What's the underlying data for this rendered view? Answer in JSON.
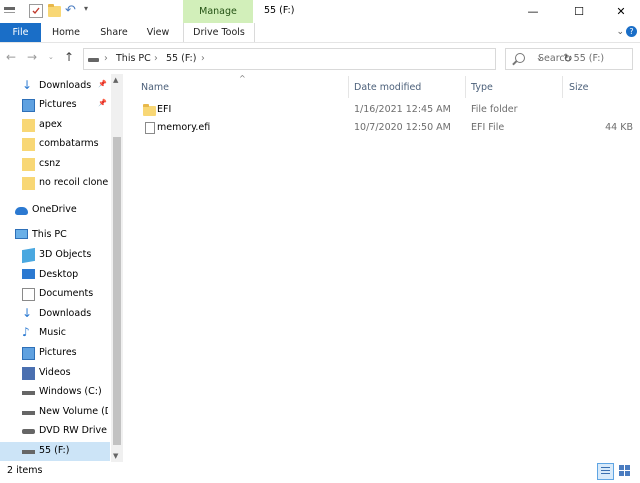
{
  "window": {
    "title": "55 (F:)",
    "controls": {
      "minimize": "—",
      "maximize": "☐",
      "close": "✕"
    }
  },
  "ribbon": {
    "context_group": "Manage",
    "tabs": [
      "File",
      "Home",
      "Share",
      "View",
      "Drive Tools"
    ],
    "help": "?"
  },
  "address": {
    "breadcrumb": [
      "This PC",
      "55 (F:)"
    ],
    "separator": "›",
    "search_placeholder": "Search 55 (F:)"
  },
  "nav_pane": {
    "items": [
      {
        "label": "Downloads",
        "icon": "downloads-icon",
        "pinned": true
      },
      {
        "label": "Pictures",
        "icon": "pictures-icon",
        "pinned": true
      },
      {
        "label": "apex",
        "icon": "folder-icon",
        "pinned": false
      },
      {
        "label": "combatarms",
        "icon": "folder-icon",
        "pinned": false
      },
      {
        "label": "csnz",
        "icon": "folder-icon",
        "pinned": false
      },
      {
        "label": "no recoil clones",
        "icon": "folder-icon",
        "pinned": false
      },
      {
        "label": "OneDrive",
        "icon": "onedrive-icon",
        "pinned": false
      },
      {
        "label": "This PC",
        "icon": "this-pc-icon",
        "pinned": false
      },
      {
        "label": "3D Objects",
        "icon": "3d-objects-icon",
        "pinned": false
      },
      {
        "label": "Desktop",
        "icon": "desktop-icon",
        "pinned": false
      },
      {
        "label": "Documents",
        "icon": "documents-icon",
        "pinned": false
      },
      {
        "label": "Downloads",
        "icon": "downloads-icon",
        "pinned": false
      },
      {
        "label": "Music",
        "icon": "music-icon",
        "pinned": false
      },
      {
        "label": "Pictures",
        "icon": "pictures-icon",
        "pinned": false
      },
      {
        "label": "Videos",
        "icon": "videos-icon",
        "pinned": false
      },
      {
        "label": "Windows (C:)",
        "icon": "drive-icon",
        "pinned": false
      },
      {
        "label": "New Volume (D:",
        "icon": "drive-icon",
        "pinned": false
      },
      {
        "label": "DVD RW Drive (E",
        "icon": "dvd-drive-icon",
        "pinned": false
      },
      {
        "label": "55 (F:)",
        "icon": "drive-icon",
        "pinned": false,
        "selected": true
      }
    ]
  },
  "file_list": {
    "columns": [
      "Name",
      "Date modified",
      "Type",
      "Size"
    ],
    "rows": [
      {
        "name": "EFI",
        "date": "1/16/2021 12:45 AM",
        "type": "File folder",
        "size": "",
        "icon": "folder-icon"
      },
      {
        "name": "memory.efi",
        "date": "10/7/2020 12:50 AM",
        "type": "EFI File",
        "size": "44 KB",
        "icon": "file-icon"
      }
    ]
  },
  "status": {
    "item_count": "2 items"
  },
  "colors": {
    "accent": "#1a6ec7",
    "manage_tab": "#d2efba",
    "selection": "#cce4f7",
    "header_text": "#4c607a"
  }
}
